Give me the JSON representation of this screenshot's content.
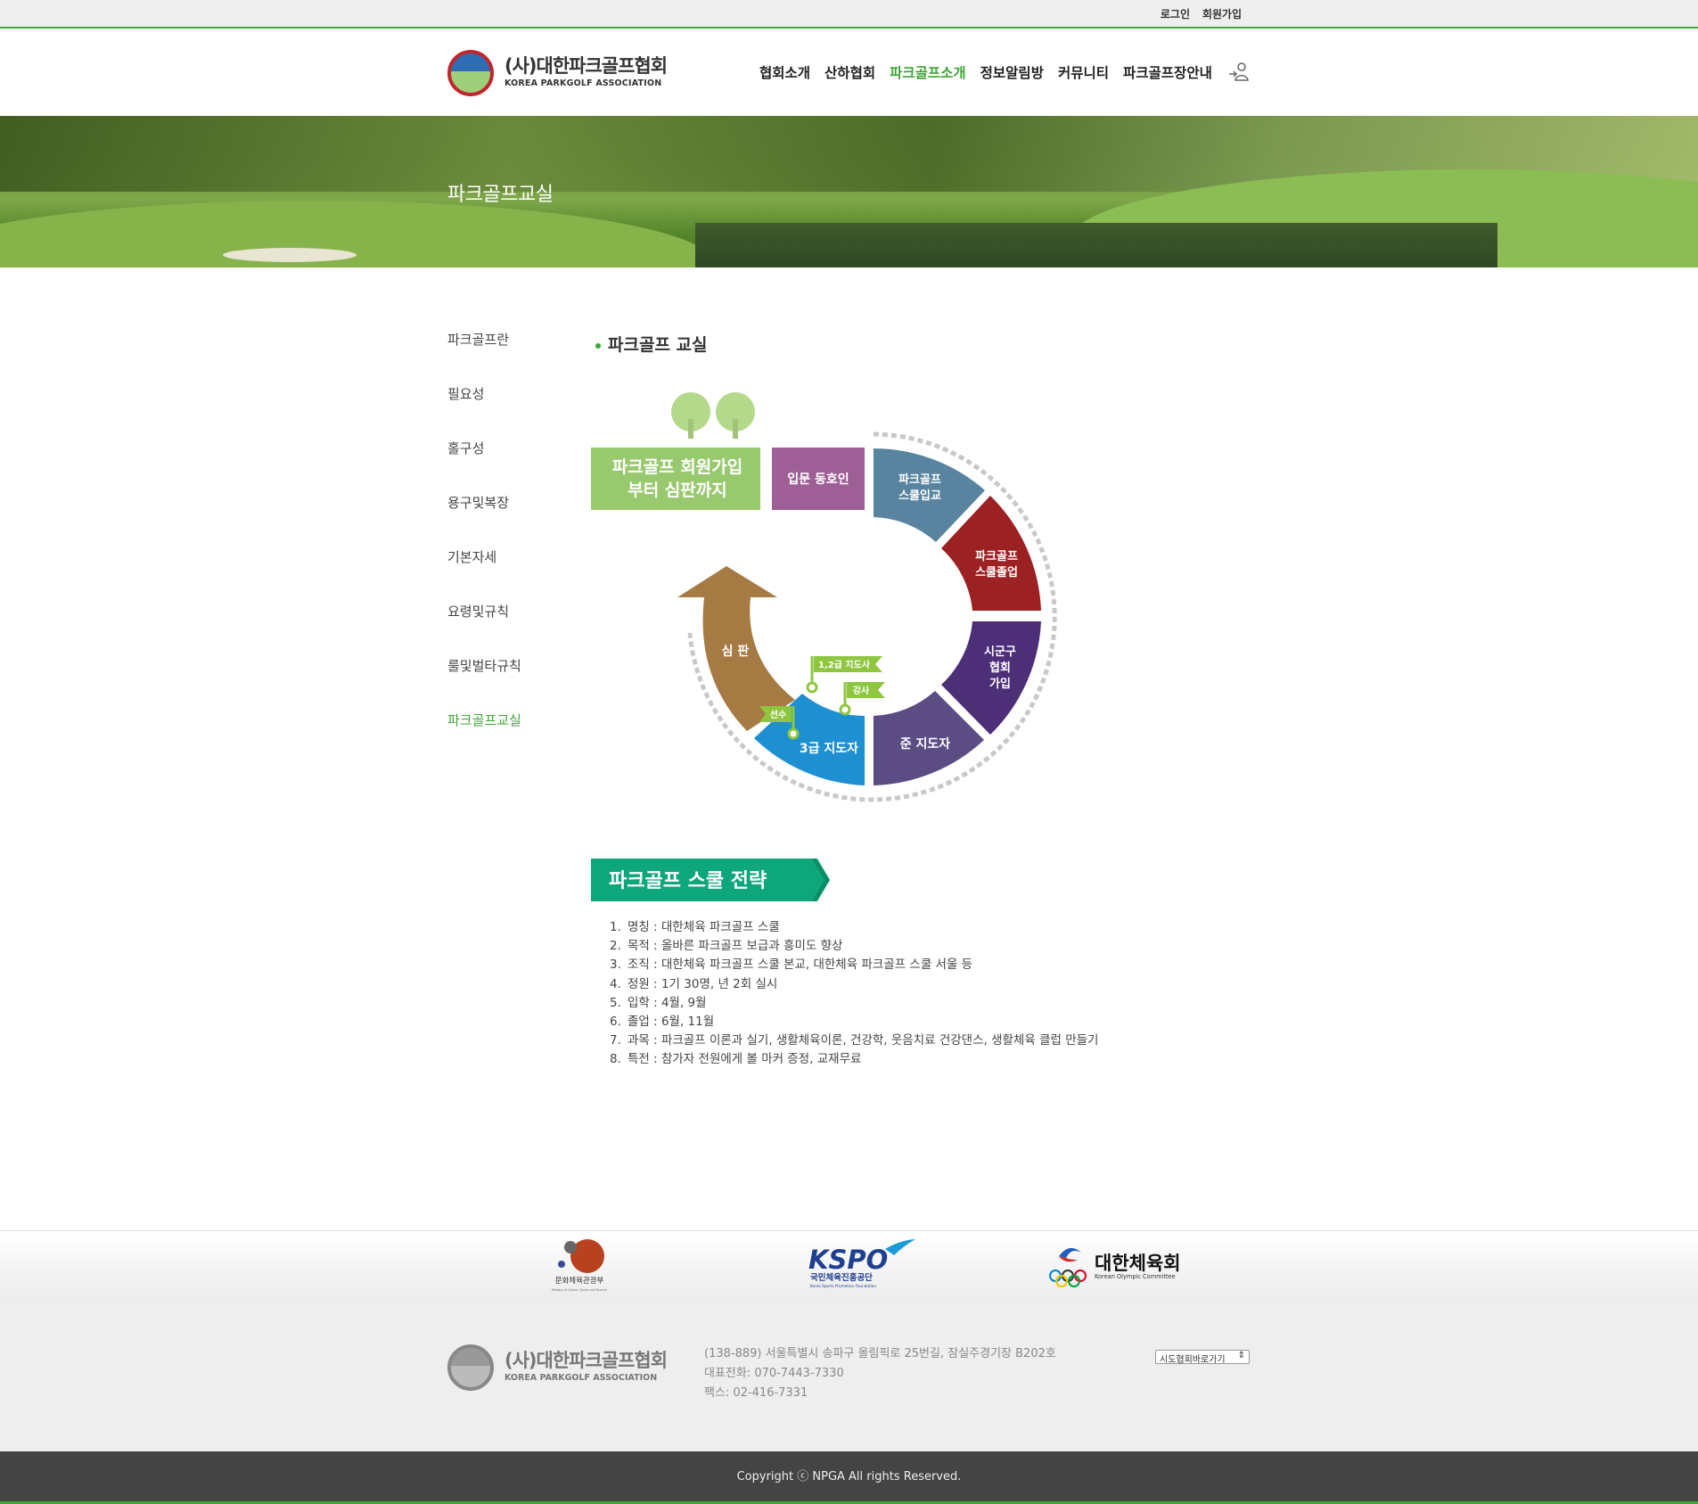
{
  "topbar": {
    "login": "로그인",
    "join": "회원가입"
  },
  "logo": {
    "kname": "(사)대한파크골프협회",
    "ename": "KOREA PARKGOLF ASSOCIATION"
  },
  "nav": [
    {
      "label": "협회소개",
      "active": false
    },
    {
      "label": "산하협회",
      "active": false
    },
    {
      "label": "파크골프소개",
      "active": true
    },
    {
      "label": "정보알림방",
      "active": false
    },
    {
      "label": "커뮤니티",
      "active": false
    },
    {
      "label": "파크골프장안내",
      "active": false
    }
  ],
  "banner": {
    "title": "파크골프교실"
  },
  "sidebar": [
    {
      "label": "파크골프란"
    },
    {
      "label": "필요성"
    },
    {
      "label": "홀구성"
    },
    {
      "label": "용구및복장"
    },
    {
      "label": "기본자세"
    },
    {
      "label": "요령및규칙"
    },
    {
      "label": "룰및벌타규칙"
    },
    {
      "label": "파크골프교실",
      "active": true
    }
  ],
  "content_title": "파크골프 교실",
  "diagram": {
    "headline_line1": "파크골프 회원가입",
    "headline_line2": "부터 심판까지",
    "step_intro": "입문 동호인",
    "step_school_line1": "파크골프",
    "step_school_line2": "스쿨입교",
    "step_grad_line1": "파크골프",
    "step_grad_line2": "스쿨졸업",
    "step_join_line1": "시군구",
    "step_join_line2": "협회",
    "step_join_line3": "가입",
    "step_sub": "준 지도자",
    "step_third": "3급 지도자",
    "step_judge": "심 판",
    "flag_12": "1,2급 지도사",
    "flag_lecturer": "강사",
    "flag_player": "선수",
    "colors": {
      "green": "#99c96f",
      "purple": "#9e5f96",
      "steel": "#5884a0",
      "red": "#9c2122",
      "indigo": "#4d2f78",
      "slate": "#5b4c84",
      "blue": "#1e8fd1",
      "brown": "#a67a43",
      "lime": "#8ec63f"
    }
  },
  "strategy": {
    "title": "파크골프 스쿨 전략",
    "items": [
      {
        "num": "1.",
        "text": "명칭 : 대한체육 파크골프 스쿨"
      },
      {
        "num": "2.",
        "text": "목적 : 올바른 파크골프 보급과 흥미도 향상"
      },
      {
        "num": "3.",
        "text": "조직 : 대한체육 파크골프 스쿨 본교, 대한체육 파크골프 스쿨 서울 등"
      },
      {
        "num": "4.",
        "text": "정원 : 1기 30명, 년 2회 실시"
      },
      {
        "num": "5.",
        "text": "입학 : 4월, 9월"
      },
      {
        "num": "6.",
        "text": "졸업 : 6월, 11월"
      },
      {
        "num": "7.",
        "text": "과목 : 파크골프 이론과 실기, 생활체육이론, 건강학, 웃음치료 건강댄스, 생활체육 클럽 만들기"
      },
      {
        "num": "8.",
        "text": "특전 : 참가자 전원에게 볼 마커 증정, 교재무료"
      }
    ]
  },
  "partners": {
    "mcst": "문화체육관광부",
    "mcst_en": "Ministry of Culture, Sports and Tourism",
    "kspo": "KSPO",
    "kspo_kr": "국민체육진흥공단",
    "kspo_en": "Korea Sports Promotion Foundation",
    "koc": "대한체육회",
    "koc_en": "Korean Olympic Committee"
  },
  "footer": {
    "address": "(138-889) 서울특별시 송파구 올림픽로 25번길, 잠실주경기장 B202호",
    "phone": "대표전화: 070-7443-7330",
    "fax": "팩스: 02-416-7331",
    "select_label": "시도협회바로가기",
    "copyright": "Copyright ⓒ NPGA All rights Reserved."
  }
}
